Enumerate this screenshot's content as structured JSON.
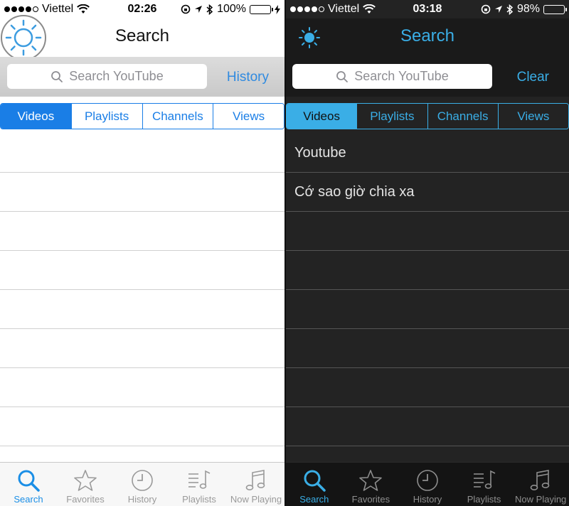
{
  "light": {
    "status": {
      "carrier": "Viettel",
      "time": "02:26",
      "battery": "100%",
      "battery_level": 1.0
    },
    "nav": {
      "title": "Search"
    },
    "search": {
      "placeholder": "Search YouTube",
      "side_button": "History"
    },
    "segments": [
      "Videos",
      "Playlists",
      "Channels",
      "Views"
    ],
    "active_segment": 0,
    "rows": [
      "",
      "",
      "",
      "",
      "",
      "",
      "",
      ""
    ],
    "tabs": [
      "Search",
      "Favorites",
      "History",
      "Playlists",
      "Now Playing"
    ]
  },
  "dark": {
    "status": {
      "carrier": "Viettel",
      "time": "03:18",
      "battery": "98%",
      "battery_level": 0.98
    },
    "nav": {
      "title": "Search"
    },
    "search": {
      "placeholder": "Search YouTube",
      "side_button": "Clear"
    },
    "segments": [
      "Videos",
      "Playlists",
      "Channels",
      "Views"
    ],
    "active_segment": 0,
    "rows": [
      "Youtube",
      "Cớ sao giờ chia xa",
      "",
      "",
      "",
      "",
      "",
      "",
      ""
    ],
    "tabs": [
      "Search",
      "Favorites",
      "History",
      "Playlists",
      "Now Playing"
    ]
  },
  "colors": {
    "accent_light": "#1a7ee6",
    "accent_dark": "#3aaee6",
    "battery_green": "#4cd964"
  }
}
